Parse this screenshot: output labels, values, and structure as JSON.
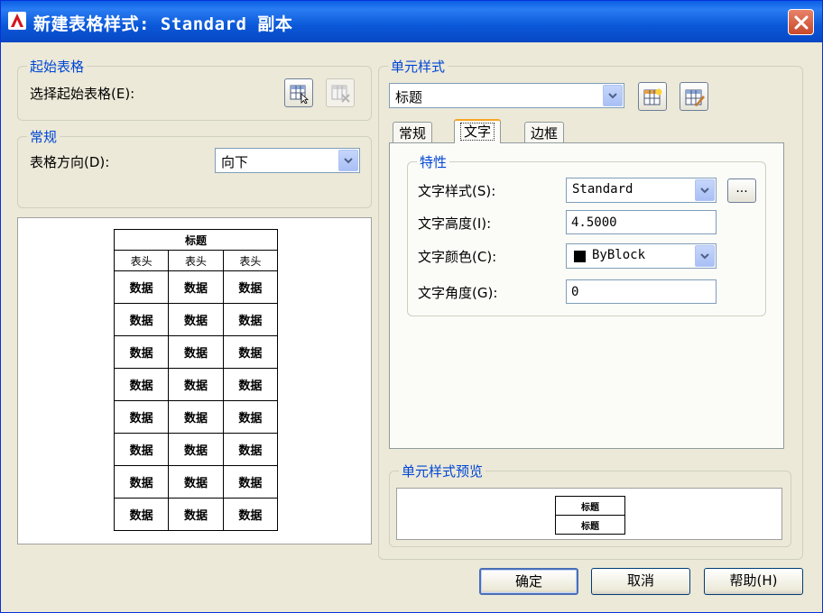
{
  "window": {
    "title": "新建表格样式: Standard 副本",
    "close_icon": "close-icon"
  },
  "start_table": {
    "group_label": "起始表格",
    "select_label": "选择起始表格(E):",
    "select_icon": "table-select-icon",
    "remove_icon": "table-remove-icon"
  },
  "general": {
    "group_label": "常规",
    "direction_label": "表格方向(D):",
    "direction_value": "向下"
  },
  "table_preview": {
    "title": "标题",
    "headers": [
      "表头",
      "表头",
      "表头"
    ],
    "cell": "数据",
    "data_rows": 8
  },
  "cell_style": {
    "group_label": "单元样式",
    "selected": "标题",
    "new_style_icon": "new-cell-style-icon",
    "manage_style_icon": "manage-cell-styles-icon"
  },
  "tabs": [
    "常规",
    "文字",
    "边框"
  ],
  "active_tab": "文字",
  "properties": {
    "group_label": "特性",
    "text_style_label": "文字样式(S):",
    "text_style_value": "Standard",
    "browse_label": "...",
    "text_height_label": "文字高度(I):",
    "text_height_value": "4.5000",
    "text_color_label": "文字颜色(C):",
    "text_color_value": "ByBlock",
    "text_angle_label": "文字角度(G):",
    "text_angle_value": "0"
  },
  "cell_preview": {
    "group_label": "单元样式预览",
    "rows": [
      "标题",
      "标题"
    ]
  },
  "buttons": {
    "ok": "确定",
    "cancel": "取消",
    "help": "帮助(H)"
  }
}
